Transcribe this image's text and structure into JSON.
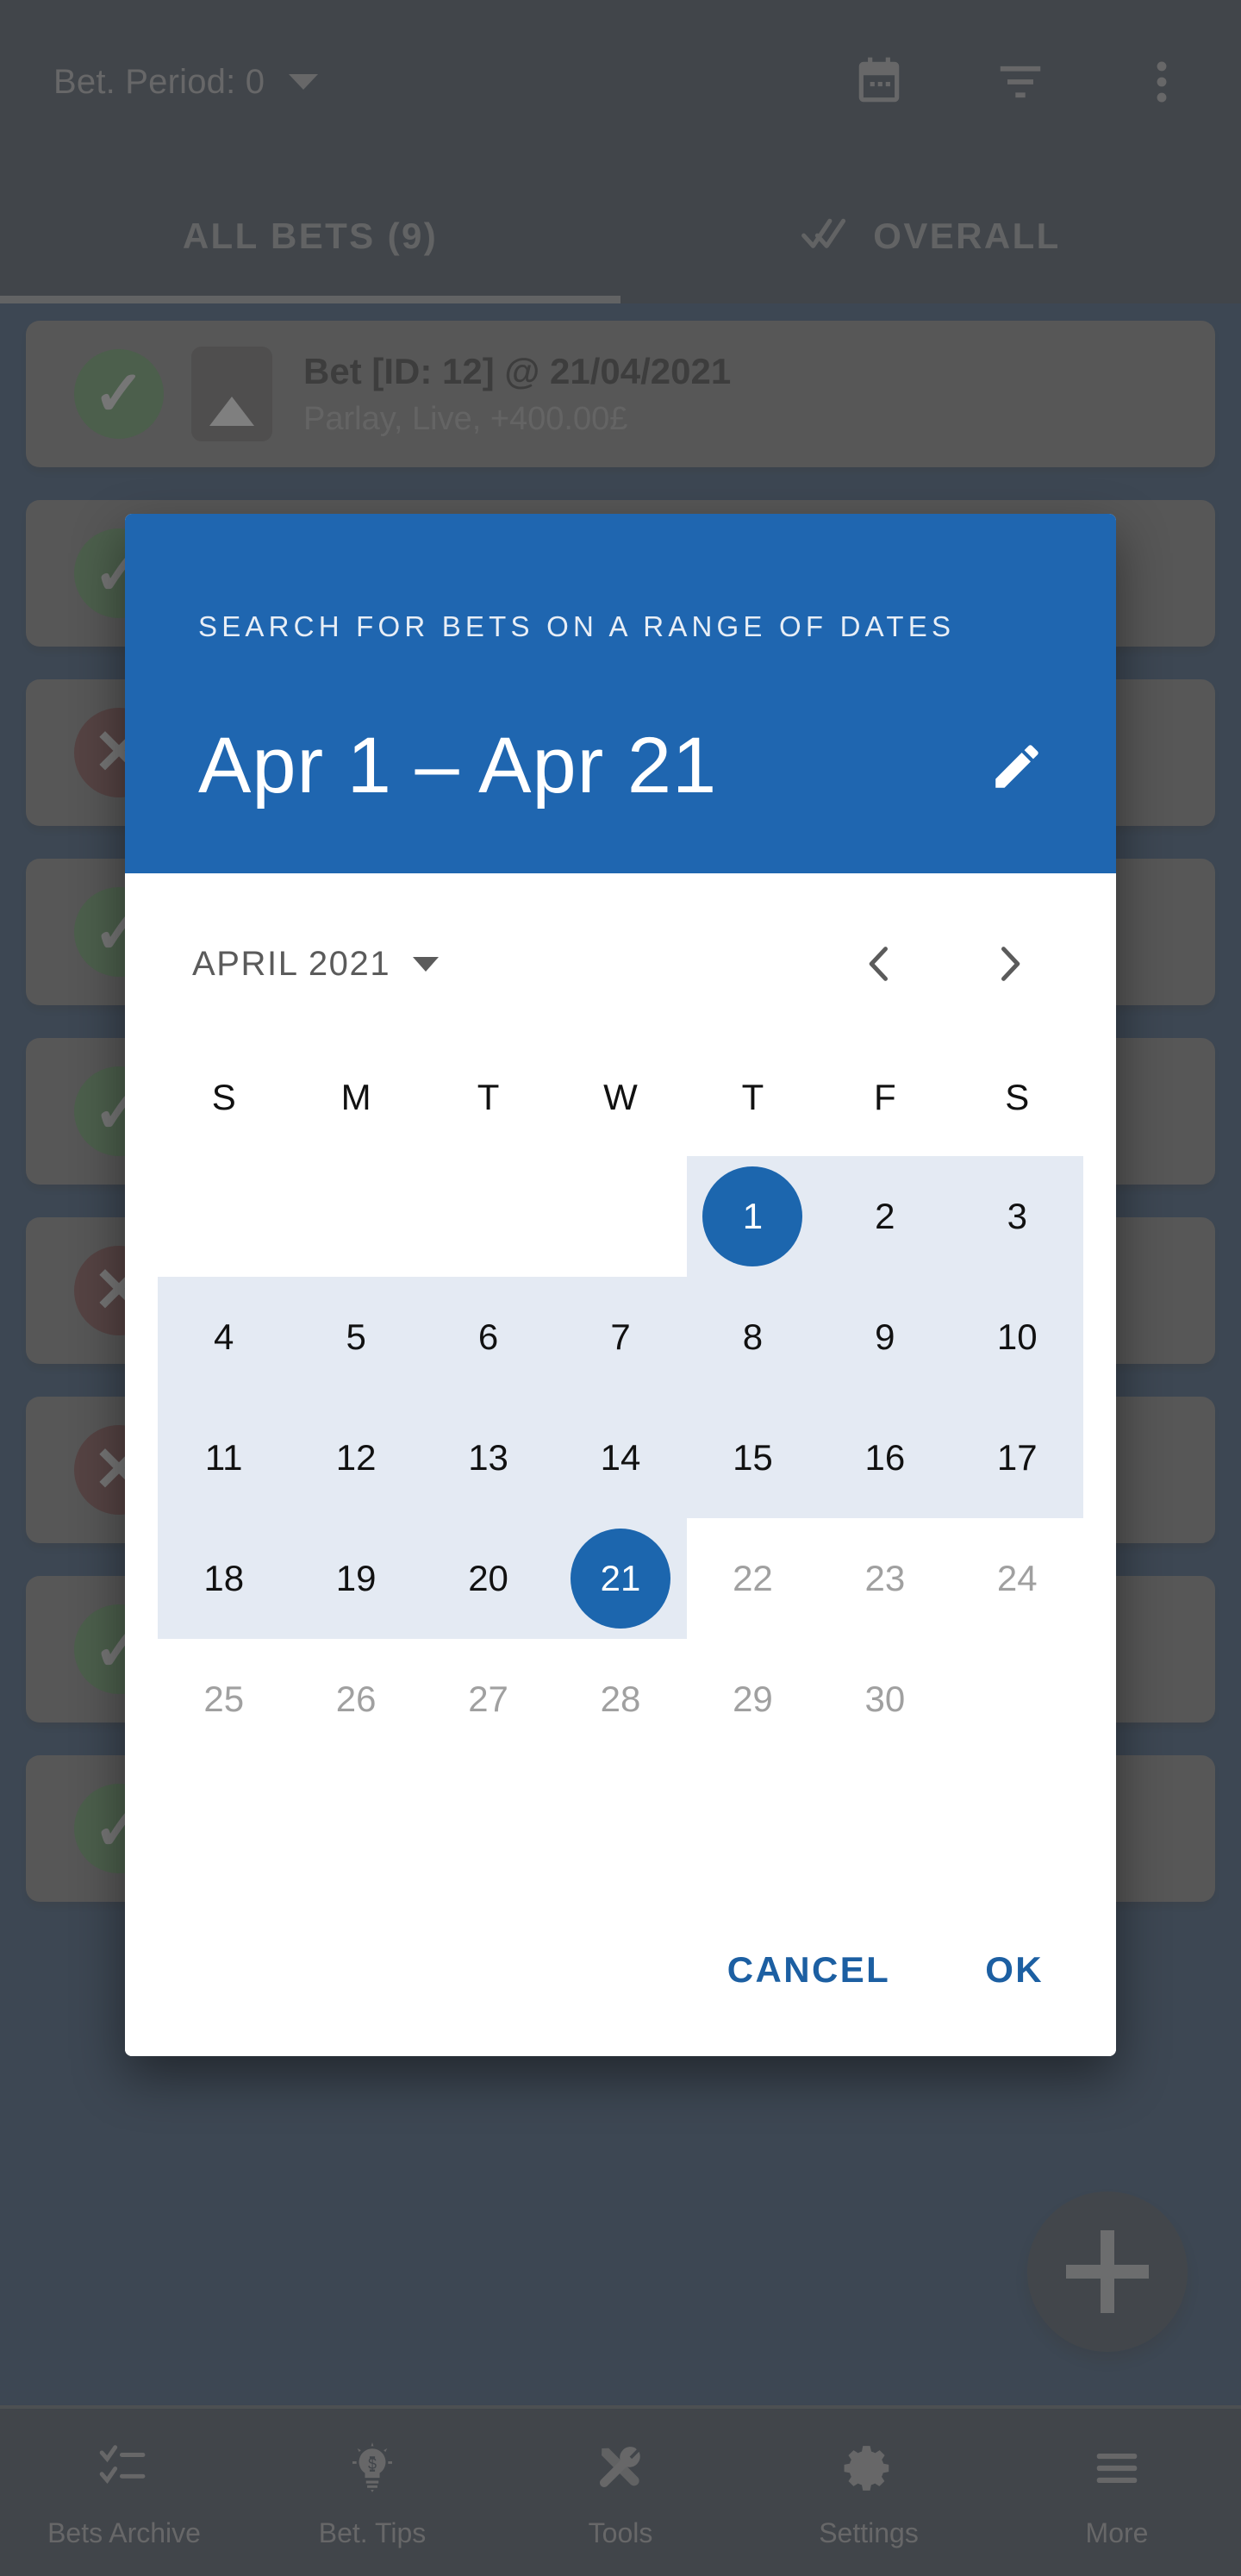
{
  "appbar": {
    "period_label": "Bet. Period: 0",
    "caret_icon": "chevron-down-icon",
    "actions": [
      {
        "name": "calendar-icon",
        "label": "Calendar"
      },
      {
        "name": "filter-icon",
        "label": "Filter"
      },
      {
        "name": "overflow-menu-icon",
        "label": "More options"
      }
    ]
  },
  "tabs": [
    {
      "label": "ALL BETS (9)",
      "active": true,
      "icon": null
    },
    {
      "label": "OVERALL",
      "active": false,
      "icon": "double-check-icon"
    }
  ],
  "bet_list": [
    {
      "status": "win",
      "title": "Bet [ID: 12] @ 21/04/2021",
      "subtitle": "Parlay, Live, +400.00£"
    },
    {
      "status": "win",
      "title": "",
      "subtitle": ""
    },
    {
      "status": "loss",
      "title": "",
      "subtitle": ""
    },
    {
      "status": "win",
      "title": "",
      "subtitle": ""
    },
    {
      "status": "win",
      "title": "",
      "subtitle": ""
    },
    {
      "status": "loss",
      "title": "",
      "subtitle": ""
    },
    {
      "status": "loss",
      "title": "",
      "subtitle": ""
    },
    {
      "status": "win",
      "title": "",
      "subtitle": ""
    },
    {
      "status": "win",
      "title": "",
      "subtitle": ""
    }
  ],
  "fab": {
    "icon": "plus-icon",
    "label": "Add bet"
  },
  "bottom_nav": [
    {
      "label": "Bets Archive",
      "icon": "checklist-icon"
    },
    {
      "label": "Bet. Tips",
      "icon": "lightbulb-dollar-icon"
    },
    {
      "label": "Tools",
      "icon": "tools-icon"
    },
    {
      "label": "Settings",
      "icon": "gear-icon"
    },
    {
      "label": "More",
      "icon": "hamburger-icon"
    }
  ],
  "dialog": {
    "overline": "SEARCH FOR BETS ON A RANGE OF DATES",
    "range_text": "Apr 1 – Apr 21",
    "edit_icon": "pencil-icon",
    "month_label": "APRIL 2021",
    "month_caret_icon": "chevron-down-icon",
    "prev_icon": "chevron-left-icon",
    "next_icon": "chevron-right-icon",
    "day_headers": [
      "S",
      "M",
      "T",
      "W",
      "T",
      "F",
      "S"
    ],
    "weeks": [
      [
        {
          "day": "",
          "state": "empty"
        },
        {
          "day": "",
          "state": "empty"
        },
        {
          "day": "",
          "state": "empty"
        },
        {
          "day": "",
          "state": "empty"
        },
        {
          "day": "1",
          "state": "selected-start"
        },
        {
          "day": "2",
          "state": "inrange"
        },
        {
          "day": "3",
          "state": "inrange"
        }
      ],
      [
        {
          "day": "4",
          "state": "inrange"
        },
        {
          "day": "5",
          "state": "inrange"
        },
        {
          "day": "6",
          "state": "inrange"
        },
        {
          "day": "7",
          "state": "inrange"
        },
        {
          "day": "8",
          "state": "inrange"
        },
        {
          "day": "9",
          "state": "inrange"
        },
        {
          "day": "10",
          "state": "inrange"
        }
      ],
      [
        {
          "day": "11",
          "state": "inrange"
        },
        {
          "day": "12",
          "state": "inrange"
        },
        {
          "day": "13",
          "state": "inrange"
        },
        {
          "day": "14",
          "state": "inrange"
        },
        {
          "day": "15",
          "state": "inrange"
        },
        {
          "day": "16",
          "state": "inrange"
        },
        {
          "day": "17",
          "state": "inrange"
        }
      ],
      [
        {
          "day": "18",
          "state": "inrange"
        },
        {
          "day": "19",
          "state": "inrange"
        },
        {
          "day": "20",
          "state": "inrange"
        },
        {
          "day": "21",
          "state": "selected-end"
        },
        {
          "day": "22",
          "state": "disabled"
        },
        {
          "day": "23",
          "state": "disabled"
        },
        {
          "day": "24",
          "state": "disabled"
        }
      ],
      [
        {
          "day": "25",
          "state": "disabled"
        },
        {
          "day": "26",
          "state": "disabled"
        },
        {
          "day": "27",
          "state": "disabled"
        },
        {
          "day": "28",
          "state": "disabled"
        },
        {
          "day": "29",
          "state": "disabled"
        },
        {
          "day": "30",
          "state": "disabled"
        },
        {
          "day": "",
          "state": "empty"
        }
      ]
    ],
    "cancel_label": "CANCEL",
    "ok_label": "OK"
  },
  "colors": {
    "appbar": "#102C4D",
    "dialog_header_blue": "#1F66B0",
    "selected_day_blue": "#1C66AE",
    "range_highlight": "#E4EAF3",
    "action_text_blue": "#1C5FA2",
    "win_green": "#0B8B0B",
    "loss_red": "#8C1414",
    "fab_navy": "#12304F"
  }
}
